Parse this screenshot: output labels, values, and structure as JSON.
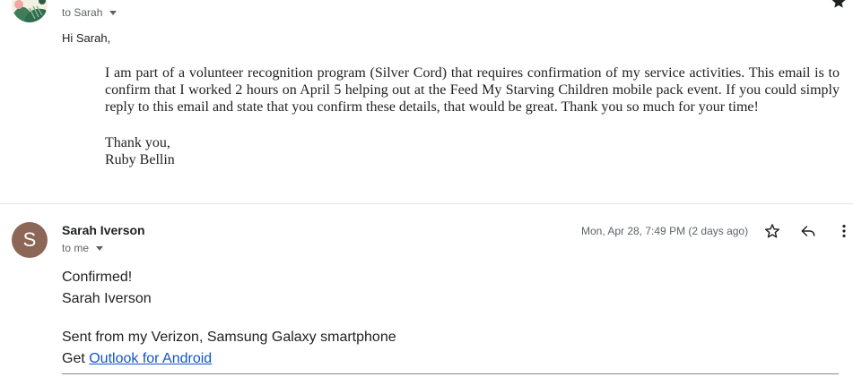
{
  "message1": {
    "to_line": "to Sarah",
    "greeting": "Hi Sarah,",
    "body": "I am part of a volunteer recognition program (Silver Cord) that requires confirmation of my service activities. This email is to confirm that I worked 2 hours on April 5 helping out at the Feed My Starving Children mobile pack event. If you could simply reply to this email and state that you confirm these details, that would be great. Thank you so much for your time!",
    "signoff": "Thank you,",
    "signature": "Ruby Bellin"
  },
  "message2": {
    "avatar_letter": "S",
    "avatar_color": "#8c6657",
    "sender": "Sarah Iverson",
    "to_line": "to me",
    "timestamp": "Mon, Apr 28, 7:49 PM (2 days ago)",
    "body_line1": "Confirmed!",
    "body_line2": "Sarah Iverson",
    "footer_line1": "Sent from my Verizon, Samsung Galaxy smartphone",
    "footer_get": "Get ",
    "footer_link": "Outlook for Android"
  },
  "icons": {
    "star": "star-icon",
    "reply": "reply-icon",
    "more": "more-vert-icon",
    "caret": "caret-down-icon"
  },
  "colors": {
    "link": "#1155cc",
    "meta_text": "#5f6368"
  }
}
